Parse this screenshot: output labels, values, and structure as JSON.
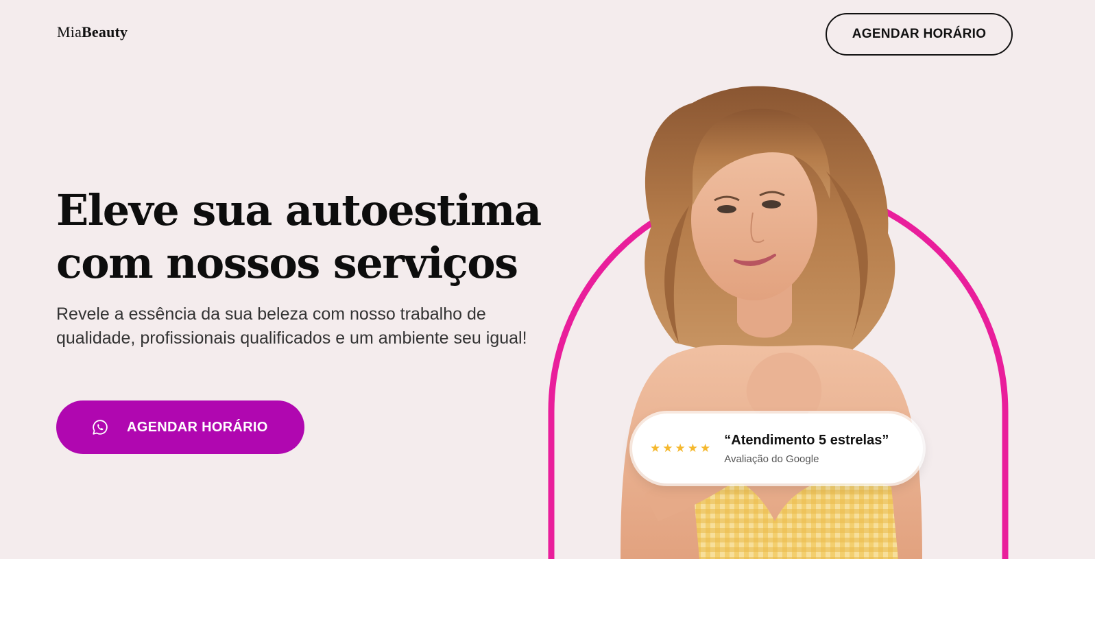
{
  "header": {
    "logo_light": "Mia",
    "logo_bold": "Beauty",
    "cta_label": "AGENDAR HORÁRIO"
  },
  "hero": {
    "headline_line1": "Eleve sua autoestima",
    "headline_line2": "com nossos serviços",
    "subtext": "Revele a essência da sua beleza com nosso trabalho de qualidade, profissionais qualificados e um ambiente seu igual!",
    "cta_label": "AGENDAR HORÁRIO",
    "cta_icon": "whatsapp-icon"
  },
  "review": {
    "stars": 5,
    "quote": "“Atendimento 5 estrelas”",
    "source": "Avaliação do Google"
  },
  "colors": {
    "background": "#f4eced",
    "accent_purple": "#b007b0",
    "arch_pink": "#e91e9b",
    "star_gold": "#f5b82e"
  }
}
